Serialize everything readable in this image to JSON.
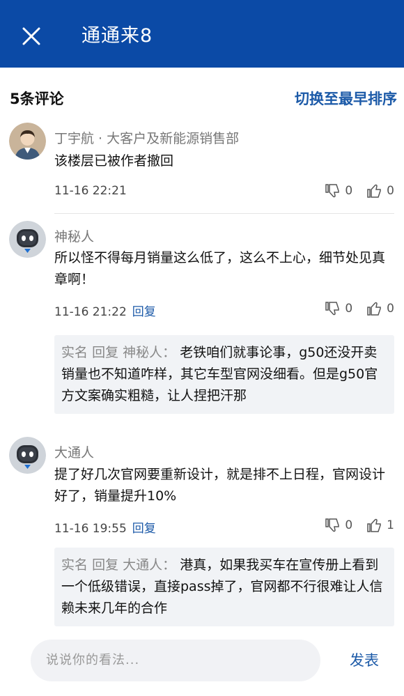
{
  "header": {
    "title": "通通来8",
    "close_icon": "close-icon"
  },
  "toolbar": {
    "count_label": "5条评论",
    "sort_label": "切换至最早排序"
  },
  "comments": [
    {
      "author": "丁宇航 · 大客户及新能源销售部",
      "text": "该楼层已被作者撤回",
      "time": "11-16 22:21",
      "reply_label": "",
      "dislikes": "0",
      "likes": "0",
      "avatar": "person-avatar"
    },
    {
      "author": "神秘人",
      "text": "所以怪不得每月销量这么低了，这么不上心，细节处见真章啊！",
      "time": "11-16 21:22",
      "reply_label": "回复",
      "dislikes": "0",
      "likes": "0",
      "avatar": "robot-avatar",
      "reply": {
        "author": "实名",
        "keyword": "回复",
        "to": "神秘人：",
        "text": "老铁咱们就事论事，g50还没开卖销量也不知道咋样，其它车型官网没细看。但是g50官方文案确实粗糙，让人捏把汗那"
      }
    },
    {
      "author": "大通人",
      "text": "提了好几次官网要重新设计，就是排不上日程，官网设计好了，销量提升10%",
      "time": "11-16 19:55",
      "reply_label": "回复",
      "dislikes": "0",
      "likes": "1",
      "avatar": "robot-avatar",
      "reply": {
        "author": "实名",
        "keyword": "回复",
        "to": "大通人：",
        "text": "港真，如果我买车在宣传册上看到一个低级错误，直接pass掉了，官网都不行很难让人信赖未来几年的合作"
      }
    }
  ],
  "bottom": {
    "placeholder": "说说你的看法...",
    "submit_label": "发表"
  },
  "colors": {
    "header_bg": "#0b4aa6",
    "accent": "#1c5aa8",
    "reply_bg": "#f1f3f6"
  }
}
